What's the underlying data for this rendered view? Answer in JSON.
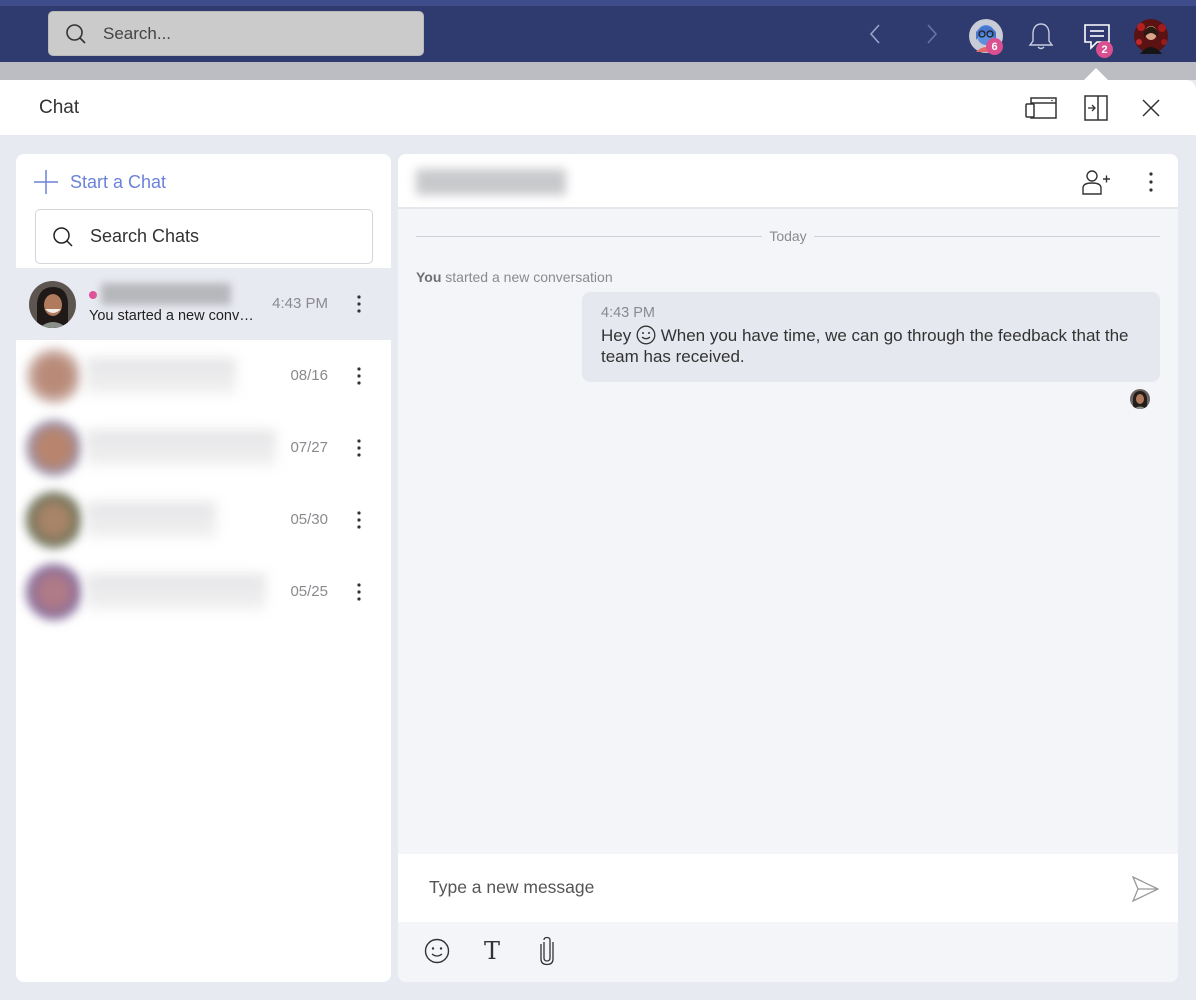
{
  "topbar": {
    "search_placeholder": "Search...",
    "apps_badge": "6",
    "chat_badge": "2",
    "colors": {
      "bar": "#2f3a6e",
      "badge": "#d94f8f",
      "accent": "#6b82d8"
    }
  },
  "chat_panel": {
    "title": "Chat",
    "header_icons": [
      "popout-window-icon",
      "dock-panel-icon",
      "close-icon"
    ]
  },
  "left": {
    "start_chat_label": "Start a Chat",
    "search_placeholder": "Search Chats",
    "chats": [
      {
        "name": "",
        "preview": "You started a new conv…",
        "time": "4:43 PM",
        "unread": true,
        "active": true
      },
      {
        "name": "",
        "preview": "",
        "time": "08/16"
      },
      {
        "name": "",
        "preview": "",
        "time": "07/27"
      },
      {
        "name": "",
        "preview": "",
        "time": "05/30"
      },
      {
        "name": "",
        "preview": "",
        "time": "05/25"
      }
    ]
  },
  "conversation": {
    "day_label": "Today",
    "system_actor": "You",
    "system_text": " started a new conversation",
    "message": {
      "time": "4:43 PM",
      "text_before_emoji": "Hey ",
      "text_after_emoji": " When you have time, we can go through the feedback that the team has received."
    },
    "compose_placeholder": "Type a new message",
    "toolbar": {
      "format_label": "T"
    }
  }
}
